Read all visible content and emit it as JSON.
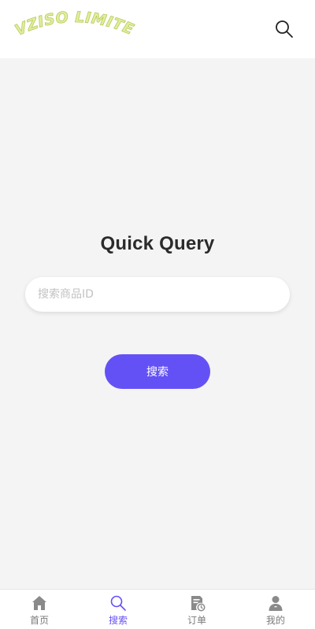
{
  "header": {
    "logo_text": "EVZISO LIMITED",
    "search_icon": "search-icon"
  },
  "main": {
    "title": "Quick Query",
    "search_placeholder": "搜索商品ID",
    "search_value": "",
    "search_button_label": "搜索"
  },
  "bottom_nav": {
    "items": [
      {
        "label": "首页",
        "icon": "home-icon",
        "active": false
      },
      {
        "label": "搜索",
        "icon": "search-icon",
        "active": true
      },
      {
        "label": "订单",
        "icon": "orders-icon",
        "active": false
      },
      {
        "label": "我的",
        "icon": "profile-icon",
        "active": false
      }
    ]
  },
  "colors": {
    "accent": "#6451f6",
    "background": "#f4f4f4",
    "logo": "#d7e68a",
    "nav_inactive": "#7a7a7a"
  }
}
